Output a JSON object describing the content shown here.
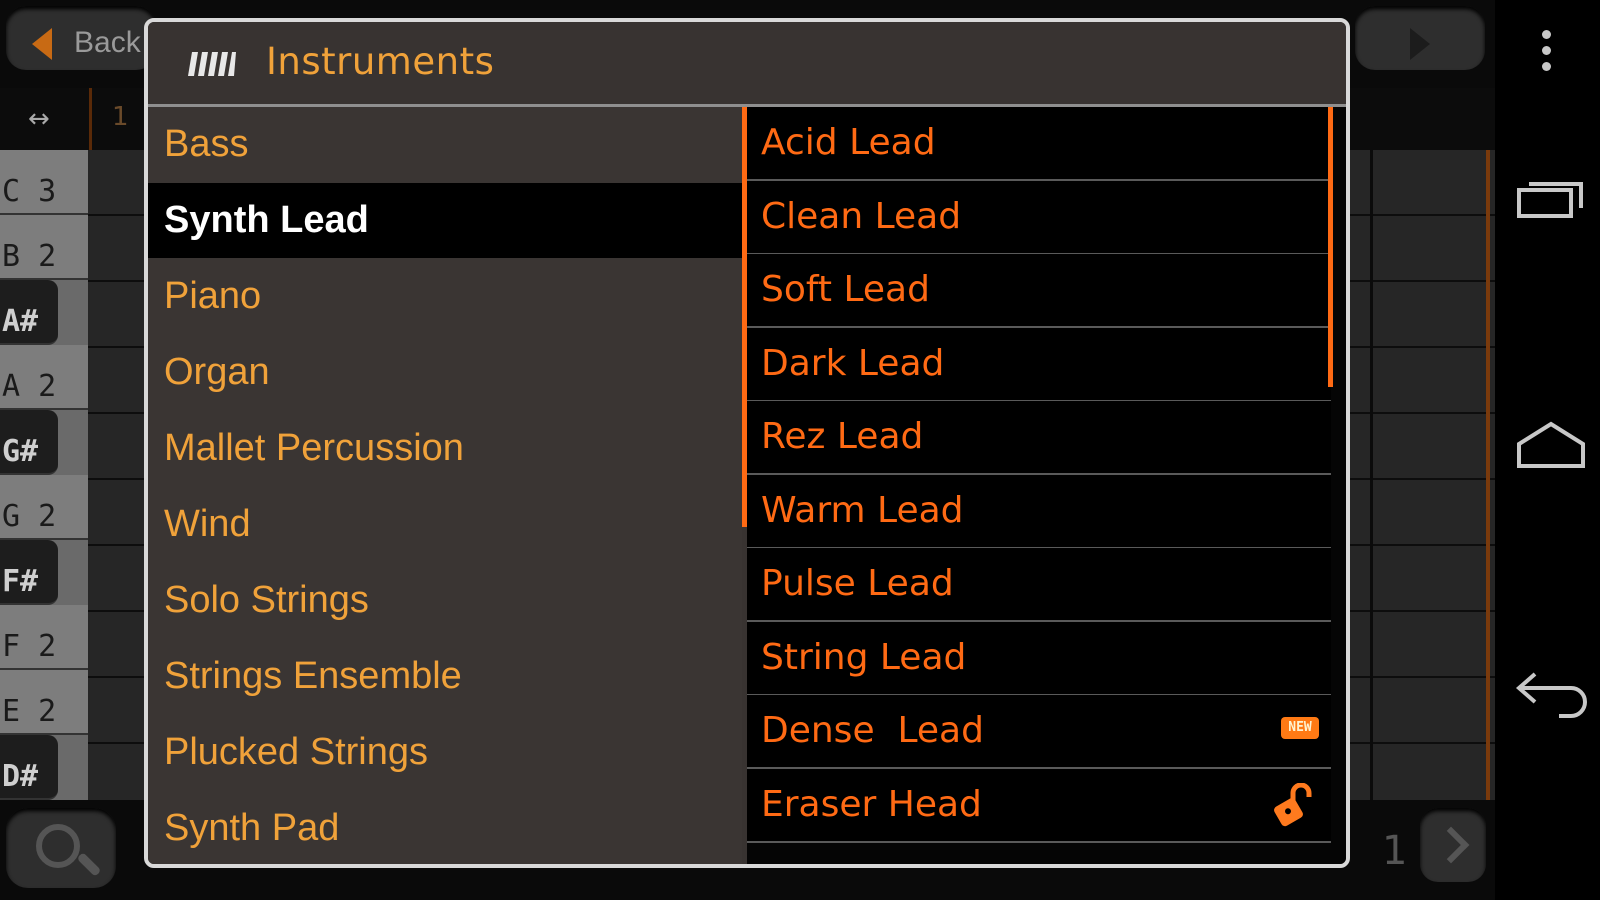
{
  "background_app": {
    "back_label": "Back",
    "ruler_bar": "1",
    "page_number": "1",
    "keys": [
      {
        "label": "C 3",
        "black": false
      },
      {
        "label": "B 2",
        "black": false
      },
      {
        "label": "A#",
        "black": true
      },
      {
        "label": "A 2",
        "black": false
      },
      {
        "label": "G#",
        "black": true
      },
      {
        "label": "G 2",
        "black": false
      },
      {
        "label": "F#",
        "black": true
      },
      {
        "label": "F 2",
        "black": false
      },
      {
        "label": "E 2",
        "black": false
      },
      {
        "label": "D#",
        "black": true
      }
    ]
  },
  "dialog": {
    "title": "Instruments",
    "categories": [
      "Bass",
      "Synth Lead",
      "Piano",
      "Organ",
      "Mallet Percussion",
      "Wind",
      "Solo Strings",
      "Strings Ensemble",
      "Plucked Strings",
      "Synth Pad"
    ],
    "selected_category": "Synth Lead",
    "presets": [
      {
        "name": "Acid Lead",
        "badge": ""
      },
      {
        "name": "Clean Lead",
        "badge": ""
      },
      {
        "name": "Soft Lead",
        "badge": ""
      },
      {
        "name": "Dark Lead",
        "badge": ""
      },
      {
        "name": "Rez Lead",
        "badge": ""
      },
      {
        "name": "Warm Lead",
        "badge": ""
      },
      {
        "name": "Pulse Lead",
        "badge": ""
      },
      {
        "name": "String Lead",
        "badge": ""
      },
      {
        "name": "Dense  Lead",
        "badge": "NEW"
      },
      {
        "name": "Eraser Head",
        "badge": "lock-icon"
      }
    ]
  },
  "colors": {
    "accent_orange": "#ff6a14",
    "category_text": "#f0a23a",
    "dialog_bg": "#383331"
  }
}
